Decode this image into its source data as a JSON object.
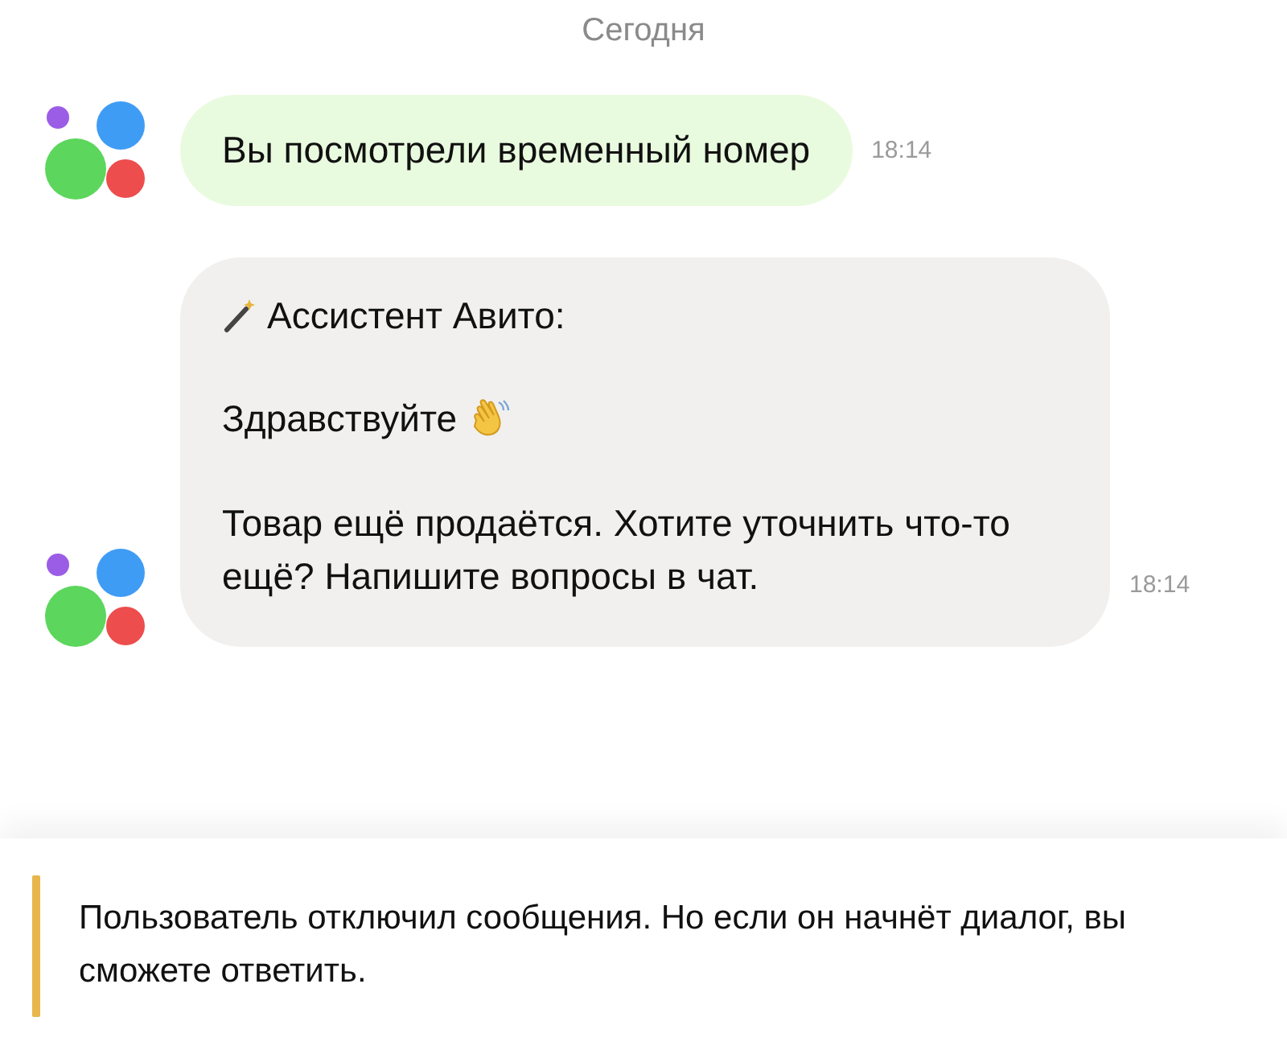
{
  "date_divider": "Сегодня",
  "messages": [
    {
      "kind": "notice",
      "text": "Вы посмотрели временный номер",
      "time": "18:14"
    },
    {
      "kind": "assistant",
      "sender": "Ассистент Авито:",
      "greeting": "Здравствуйте",
      "text": "Товар ещё продаётся. Хотите уточнить что-то ещё? Напишите вопросы в чат.",
      "time": "18:14"
    }
  ],
  "banner": {
    "text": "Пользователь отключил сообщения. Но если он начнёт диалог, вы сможете ответить."
  }
}
